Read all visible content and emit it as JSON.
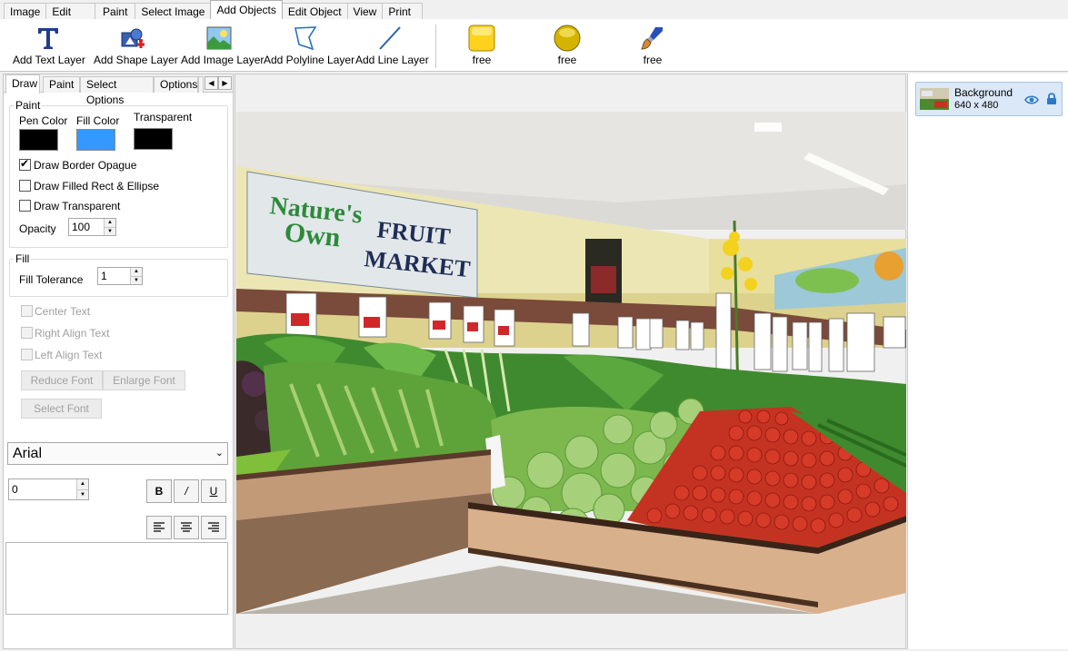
{
  "menu_tabs": [
    {
      "label": "Image"
    },
    {
      "label": "Edit"
    },
    {
      "label": "Paint"
    },
    {
      "label": "Select Image"
    },
    {
      "label": "Add Objects",
      "active": true
    },
    {
      "label": "Edit Object"
    },
    {
      "label": "View"
    },
    {
      "label": "Print"
    }
  ],
  "ribbon": {
    "add_text_layer": "Add Text Layer",
    "add_shape_layer": "Add Shape Layer",
    "add_image_layer": "Add Image Layer",
    "add_polyline_layer": "Add Polyline Layer",
    "add_line_layer": "Add Line Layer",
    "free_1": "free",
    "free_2": "free",
    "free_3": "free",
    "icons": [
      "text-T-icon",
      "shape-icon",
      "image-icon",
      "polyline-icon",
      "line-icon",
      "yellow-square-icon",
      "yellow-circle-icon",
      "brush-icon"
    ]
  },
  "panel_tabs": [
    "Draw",
    "Paint",
    "Select Options",
    "Options"
  ],
  "paint": {
    "legend": "Paint",
    "pen_color_label": "Pen Color",
    "fill_color_label": "Fill Color",
    "transparent_label": "Transparent",
    "pen_color": "#000000",
    "fill_color": "#3399ff",
    "transparent_color": "#000000",
    "draw_border_opaque": "Draw Border Opague",
    "draw_border_opaque_checked": true,
    "draw_filled": "Draw Filled Rect & Ellipse",
    "draw_transparent": "Draw Transparent",
    "opacity_label": "Opacity",
    "opacity_value": "100"
  },
  "fill": {
    "legend": "Fill",
    "tolerance_label": "Fill Tolerance",
    "tolerance_value": "1"
  },
  "text_options": {
    "center_text": "Center Text",
    "right_align_text": "Right Align Text",
    "left_align_text": "Left Align Text",
    "reduce_font": "Reduce Font",
    "enlarge_font": "Enlarge Font",
    "select_font": "Select Font",
    "font_name": "Arial",
    "font_size": "0",
    "bold": "B",
    "italic": "/",
    "underline": "U"
  },
  "layers": [
    {
      "name": "Background",
      "size": "640 x 480"
    }
  ],
  "image_signage": {
    "brand_line1": "Nature's",
    "brand_line2": "Own",
    "sign_line1": "FRUIT",
    "sign_line2": "MARKET"
  },
  "colors": {
    "accent": "#3399ff",
    "layer_selected": "#dbe8f7"
  }
}
